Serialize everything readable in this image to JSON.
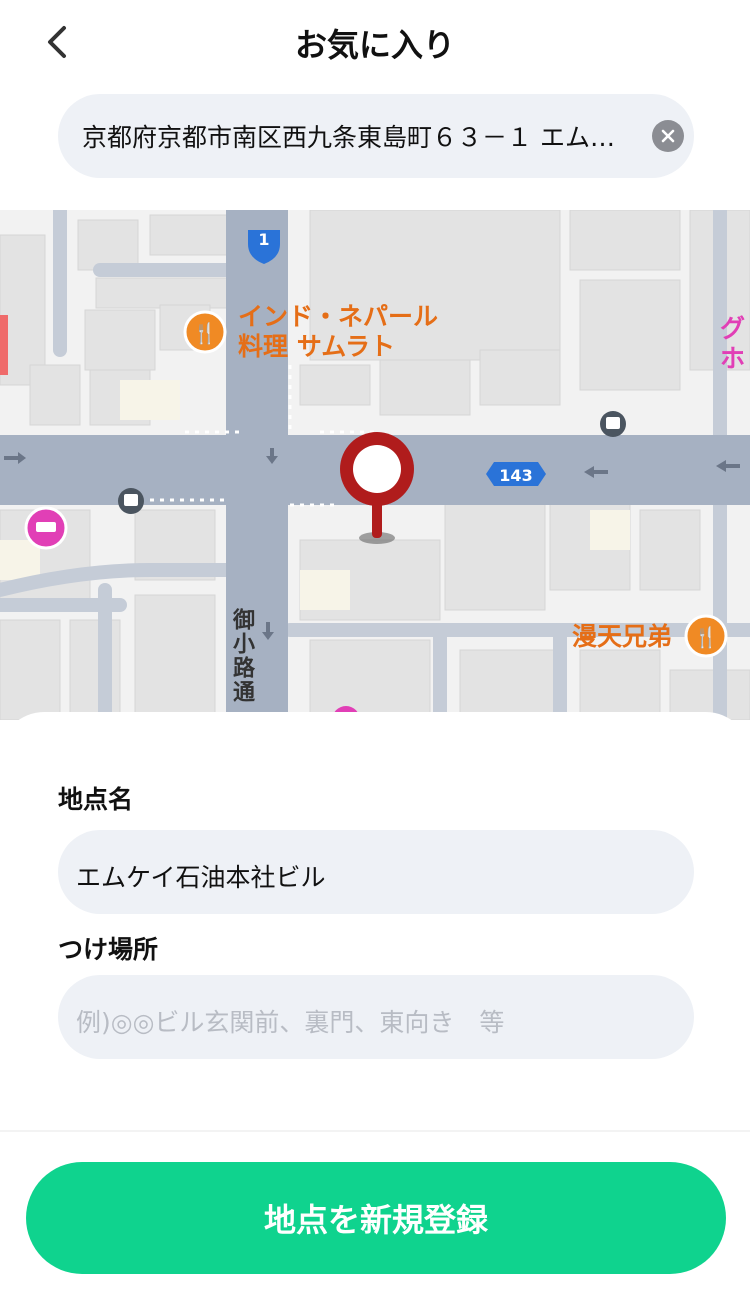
{
  "header": {
    "title": "お気に入り",
    "back_icon": "chevron-left-icon"
  },
  "search": {
    "value": "京都府京都市南区西九条東島町６３－１ エム…",
    "clear_icon": "clear-circle-icon"
  },
  "map": {
    "pois": [
      {
        "name": "インド・ネパール",
        "name2": "料理 サムラト",
        "icon": "restaurant-icon"
      },
      {
        "name": "漫天兄弟",
        "icon": "restaurant-icon"
      },
      {
        "name": "グ",
        "name2": "ホ",
        "icon": "hotel-icon"
      }
    ],
    "route_badges": [
      "1",
      "143"
    ],
    "road_name": "御小路通",
    "pin_icon": "location-pin-icon",
    "colors": {
      "poi_orange": "#e56e17",
      "poi_pink": "#e13fb6",
      "road": "#a8b3c4",
      "road_major": "#8d9bb1"
    }
  },
  "form": {
    "place_name_label": "地点名",
    "place_name_value": "エムケイ石油本社ビル",
    "attach_label": "つけ場所",
    "attach_placeholder": "例)◎◎ビル玄関前、裏門、東向き　等"
  },
  "register_button": {
    "label": "地点を新規登録",
    "color": "#0fd38e"
  }
}
